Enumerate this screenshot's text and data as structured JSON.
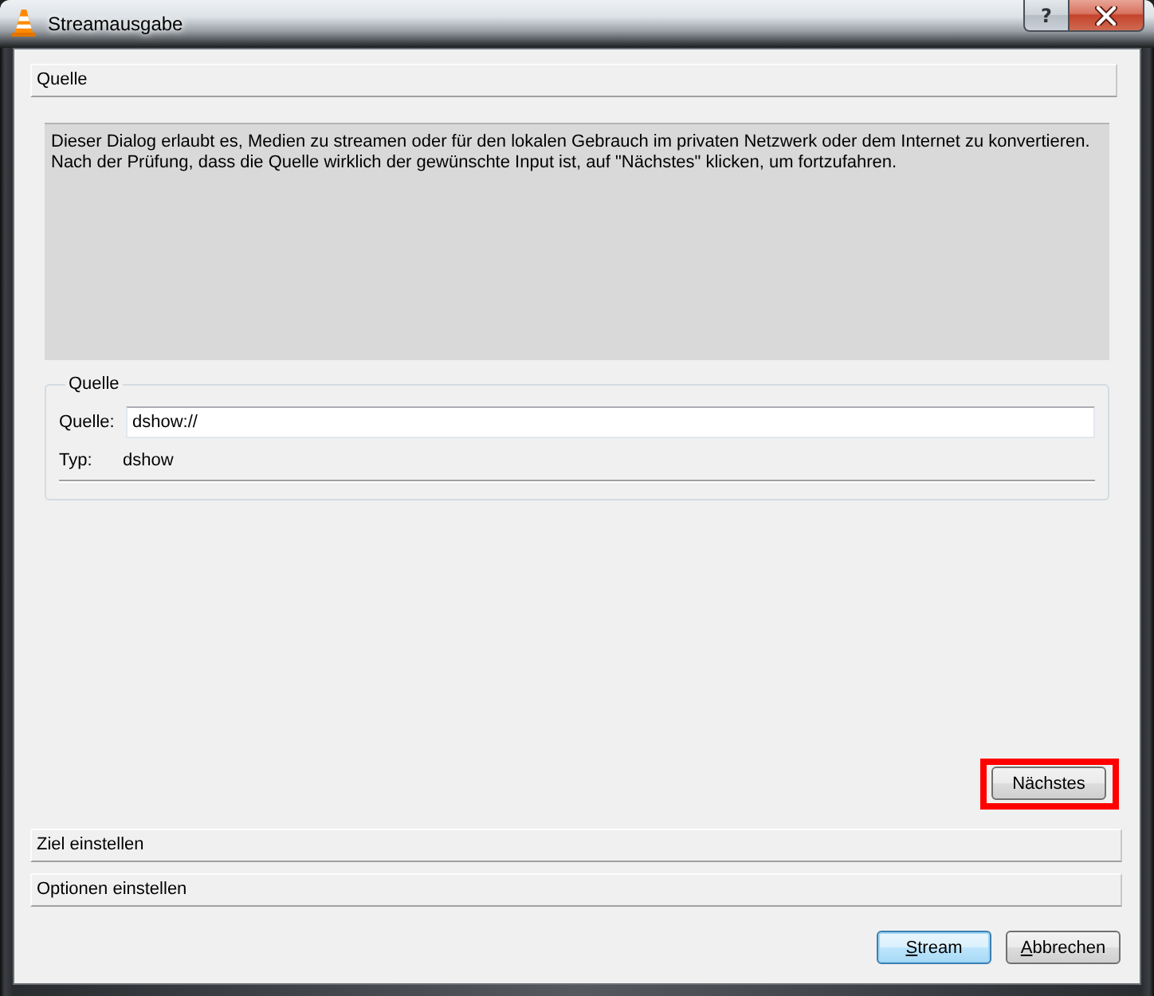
{
  "window": {
    "title": "Streamausgabe",
    "caption_buttons": [
      {
        "kind": "help",
        "label": "?"
      },
      {
        "kind": "close"
      }
    ]
  },
  "sections": [
    {
      "title": "Quelle",
      "expanded": true,
      "description": [
        "Dieser Dialog erlaubt es, Medien zu streamen oder für den lokalen Gebrauch im privaten Netzwerk oder dem Internet zu konvertieren.",
        "Nach der Prüfung, dass die Quelle wirklich der gewünschte Input ist, auf \"Nächstes\" klicken, um fortzufahren."
      ],
      "group": {
        "title": "Quelle",
        "fields": [
          {
            "kind": "input",
            "label": "Quelle:",
            "value": "dshow://"
          },
          {
            "kind": "text",
            "label": "Typ:",
            "value": "dshow"
          }
        ]
      },
      "next_button": {
        "label": "Nächstes",
        "marked": true
      }
    },
    {
      "title": "Ziel einstellen",
      "expanded": false
    },
    {
      "title": "Optionen einstellen",
      "expanded": false
    }
  ],
  "footer_buttons": [
    {
      "label": "Stream",
      "default": true,
      "access_key_underlined": true
    },
    {
      "label": "Abbrechen",
      "default": false,
      "access_key_underlined": true
    }
  ]
}
